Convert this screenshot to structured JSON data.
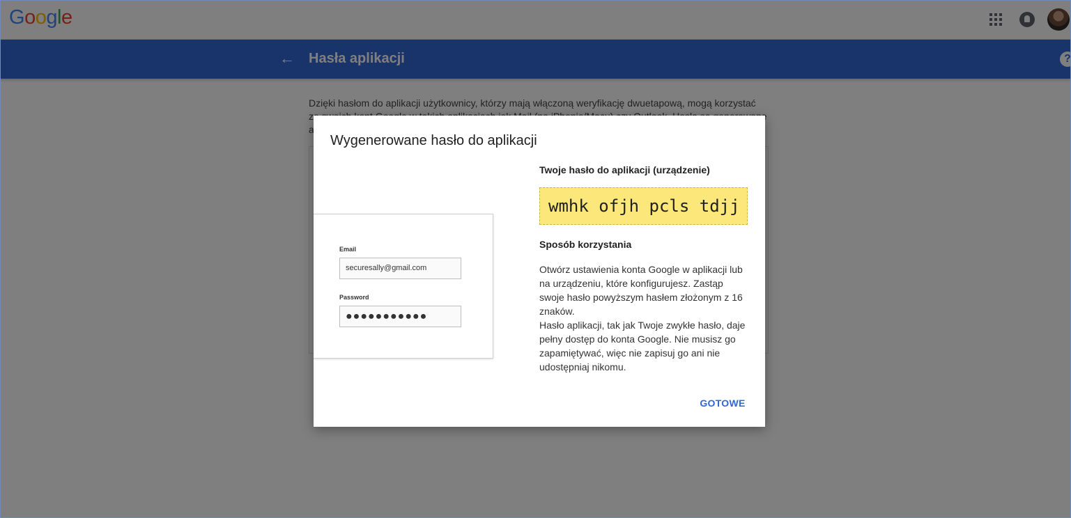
{
  "header": {
    "logo": [
      "G",
      "o",
      "o",
      "g",
      "l",
      "e"
    ],
    "logo_colors": [
      "#4285F4",
      "#EA4335",
      "#FBBC05",
      "#4285F4",
      "#34A853",
      "#EA4335"
    ],
    "apps_icon": "apps-grid-icon",
    "notifications_icon": "notifications-icon",
    "avatar": "user-avatar"
  },
  "page": {
    "title": "Hasła aplikacji",
    "back_icon": "arrow-back-icon",
    "help_icon": "help-icon",
    "accent_color": "#3367d6",
    "intro_text": "Dzięki hasłom do aplikacji użytkownicy, którzy mają włączoną weryfikację dwuetapową, mogą korzystać ze swoich kont Google w takich aplikacjach jak Mail (na iPhonie/Macu) czy Outlook. Hasła są generowane automatycznie."
  },
  "dialog": {
    "title": "Wygenerowane hasło do aplikacji",
    "illustration": {
      "email_label": "Email",
      "email_value": "securesally@gmail.com",
      "password_label": "Password",
      "password_value": "●●●●●●●●●●●"
    },
    "password_heading": "Twoje hasło do aplikacji (urządzenie)",
    "password": "wmhk ofjh pcls tdjj",
    "password_bg_color": "#fbe77a",
    "usage_heading": "Sposób korzystania",
    "usage_paragraph_1": "Otwórz ustawienia konta Google w aplikacji lub na urządzeniu, które konfigurujesz. Zastąp swoje hasło powyższym hasłem złożonym z 16 znaków.",
    "usage_paragraph_2": "Hasło aplikacji, tak jak Twoje zwykłe hasło, daje pełny dostęp do konta Google. Nie musisz go zapamiętywać, więc nie zapisuj go ani nie udostępniaj nikomu.",
    "done_label": "GOTOWE"
  }
}
